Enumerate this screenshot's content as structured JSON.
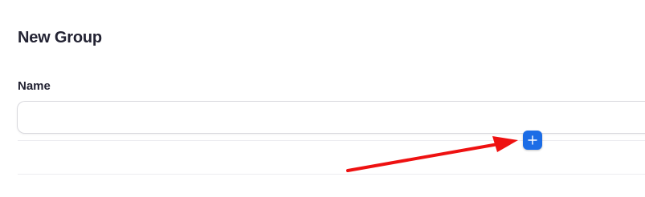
{
  "page": {
    "title": "New Group"
  },
  "form": {
    "name_label": "Name",
    "name_value": "",
    "name_placeholder": ""
  },
  "add_button": {
    "icon": "plus-icon",
    "color": "#1c6de6"
  },
  "annotation": {
    "type": "arrow",
    "color": "#ee1111",
    "points_to": "add-button"
  }
}
